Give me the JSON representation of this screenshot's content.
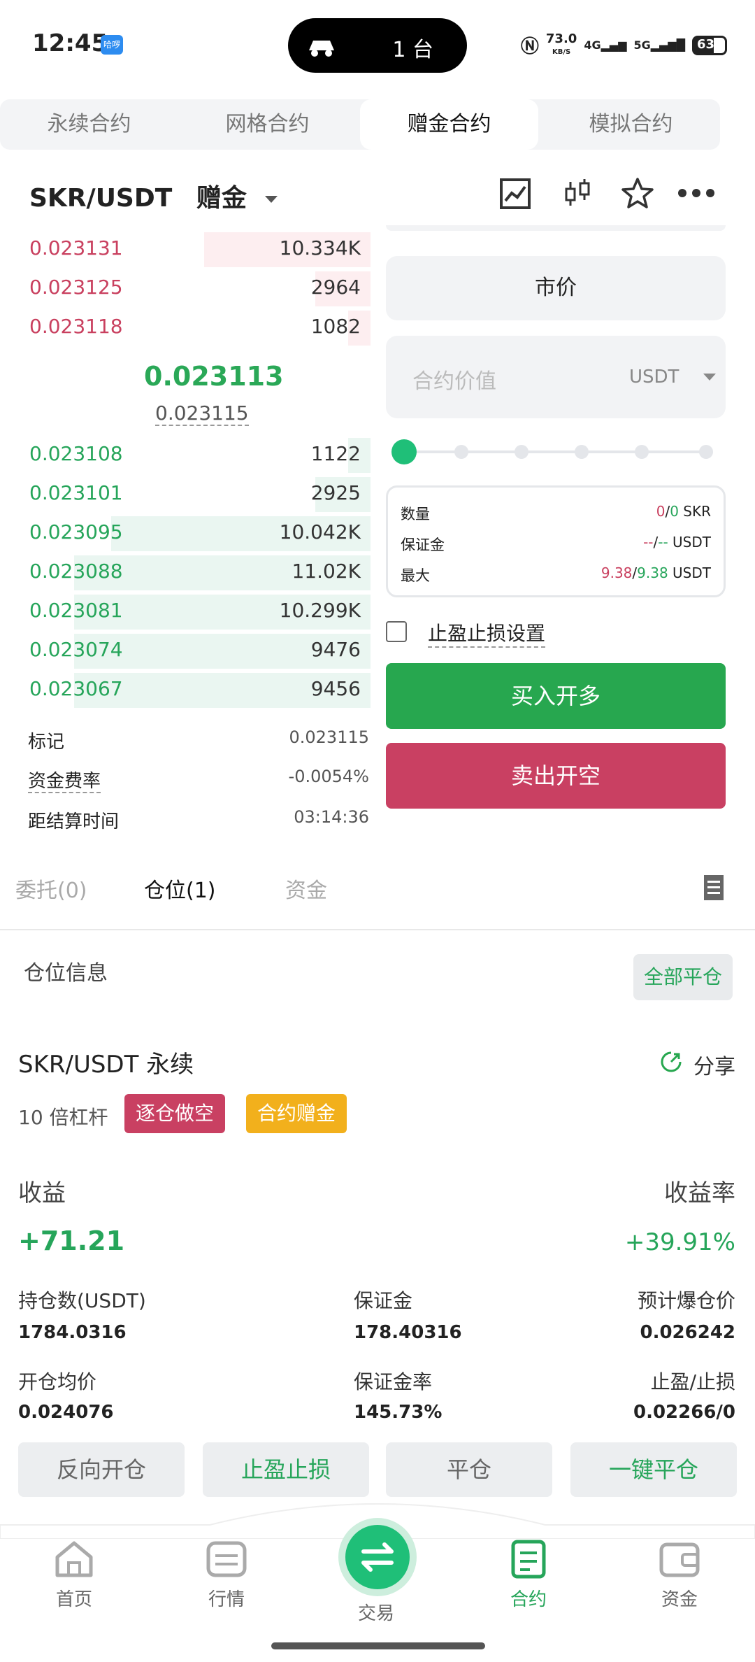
{
  "status": {
    "time": "12:45",
    "app_badge": "哈啰",
    "island_count": "1 台",
    "net_speed": "73.0",
    "net_unit": "KB/S",
    "signal1": "4G",
    "signal2": "5G",
    "battery": "63"
  },
  "top_tabs": [
    "永续合约",
    "网格合约",
    "赠金合约",
    "模拟合约"
  ],
  "pair": {
    "name": "SKR/USDT",
    "mode": "赠金"
  },
  "colors": {
    "green": "#26a55a",
    "red": "#c9405f",
    "yellow": "#f2b01c"
  },
  "orderbook": {
    "asks": [
      {
        "price": "0.023131",
        "qty": "10.334K",
        "depth": 0.45
      },
      {
        "price": "0.023125",
        "qty": "2964",
        "depth": 0.15
      },
      {
        "price": "0.023118",
        "qty": "1082",
        "depth": 0.06
      }
    ],
    "last_price": "0.023113",
    "index_price": "0.023115",
    "bids": [
      {
        "price": "0.023108",
        "qty": "1122",
        "depth": 0.06
      },
      {
        "price": "0.023101",
        "qty": "2925",
        "depth": 0.15
      },
      {
        "price": "0.023095",
        "qty": "10.042K",
        "depth": 0.7
      },
      {
        "price": "0.023088",
        "qty": "11.02K",
        "depth": 0.8
      },
      {
        "price": "0.023081",
        "qty": "10.299K",
        "depth": 0.8
      },
      {
        "price": "0.023074",
        "qty": "9476",
        "depth": 0.8
      },
      {
        "price": "0.023067",
        "qty": "9456",
        "depth": 0.8
      }
    ]
  },
  "market_info": [
    {
      "label": "标记",
      "value": "0.023115"
    },
    {
      "label": "资金费率",
      "value": "-0.0054%"
    },
    {
      "label": "距结算时间",
      "value": "03:14:36"
    }
  ],
  "order_form": {
    "order_type": "市价",
    "value_placeholder": "合约价值",
    "value_unit": "USDT",
    "slider_percent": 0,
    "summary": [
      {
        "label": "数量",
        "v1": "0",
        "v2": "0",
        "unit": "SKR"
      },
      {
        "label": "保证金",
        "v1": "--",
        "v2": "--",
        "unit": "USDT"
      },
      {
        "label": "最大",
        "v1": "9.38",
        "v2": "9.38",
        "unit": "USDT"
      }
    ],
    "tpsl_label": "止盈止损设置",
    "buy_label": "买入开多",
    "sell_label": "卖出开空"
  },
  "sub_tabs": [
    "委托(0)",
    "仓位(1)",
    "资金"
  ],
  "position": {
    "section_title": "仓位信息",
    "close_all": "全部平仓",
    "symbol": "SKR/USDT 永续",
    "share": "分享",
    "leverage": "10 倍杠杆",
    "tag_side": "逐仓做空",
    "tag_bonus": "合约赠金",
    "pnl_label": "收益",
    "pnl_value": "+71.21",
    "roe_label": "收益率",
    "roe_value": "+39.91%",
    "size_label": "持仓数(USDT)",
    "size_value": "1784.0316",
    "margin_label": "保证金",
    "margin_value": "178.40316",
    "liq_label": "预计爆仓价",
    "liq_value": "0.026242",
    "entry_label": "开仓均价",
    "entry_value": "0.024076",
    "margin_rate_label": "保证金率",
    "margin_rate_value": "145.73%",
    "tpsl_label": "止盈/止损",
    "tpsl_value": "0.02266/0"
  },
  "actions": [
    "反向开仓",
    "止盈止损",
    "平仓",
    "一键平仓"
  ],
  "bottom_nav": [
    "首页",
    "行情",
    "交易",
    "合约",
    "资金"
  ]
}
